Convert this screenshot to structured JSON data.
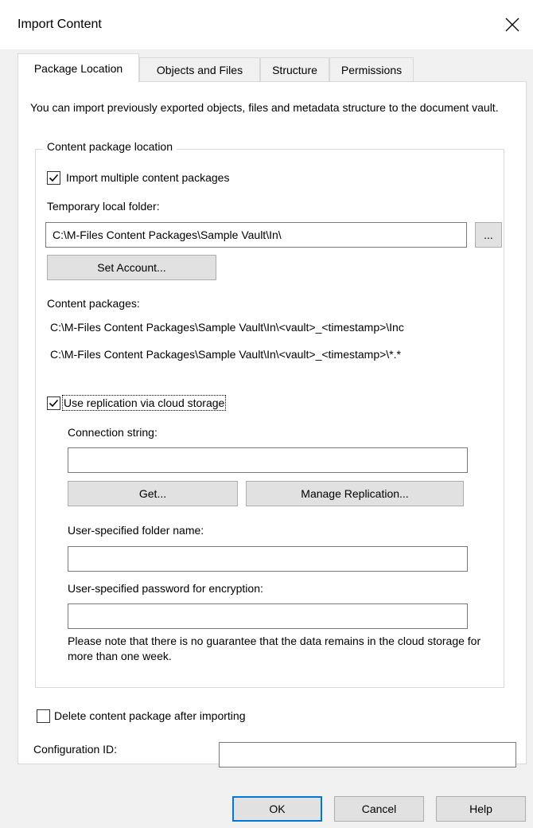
{
  "window": {
    "title": "Import Content"
  },
  "tabs": [
    {
      "label": "Package Location",
      "active": true
    },
    {
      "label": "Objects and Files",
      "active": false
    },
    {
      "label": "Structure",
      "active": false
    },
    {
      "label": "Permissions",
      "active": false
    }
  ],
  "package_location": {
    "intro": "You can import previously exported objects, files and metadata structure to the document vault.",
    "group_label": "Content package location",
    "import_multiple": {
      "label": "Import multiple content packages",
      "checked": true
    },
    "temp_folder_label": "Temporary local folder:",
    "temp_folder_value": "C:\\M-Files Content Packages\\Sample Vault\\In\\",
    "browse_label": "...",
    "set_account_label": "Set Account...",
    "content_packages_label": "Content packages:",
    "content_packages": [
      "C:\\M-Files Content Packages\\Sample Vault\\In\\<vault>_<timestamp>\\Inc",
      "C:\\M-Files Content Packages\\Sample Vault\\In\\<vault>_<timestamp>\\*.*"
    ],
    "use_replication": {
      "label": "Use replication via cloud storage",
      "checked": true
    },
    "connection_string_label": "Connection string:",
    "connection_string_value": "",
    "get_label": "Get...",
    "manage_replication_label": "Manage Replication...",
    "folder_name_label": "User-specified folder name:",
    "folder_name_value": "",
    "password_label": "User-specified password for encryption:",
    "password_value": "",
    "note": "Please note that there is no guarantee that the data remains in the cloud storage for more than one week."
  },
  "delete_after_import": {
    "label": "Delete content package after importing",
    "checked": false
  },
  "configuration_id_label": "Configuration ID:",
  "configuration_id_value": "",
  "footer": {
    "ok_label": "OK",
    "cancel_label": "Cancel",
    "help_label": "Help"
  },
  "colors": {
    "dialog_bg": "#f0f0f0",
    "panel_bg": "#ffffff",
    "default_button_border": "#0078d7",
    "button_bg": "#e1e1e1"
  }
}
